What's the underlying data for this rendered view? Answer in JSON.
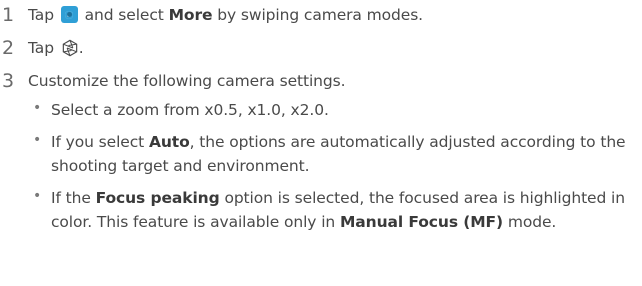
{
  "steps": [
    {
      "number": "1",
      "prefix": "Tap",
      "icon": "camera-app-icon",
      "middle": "and select",
      "bold": "More",
      "suffix": "by swiping camera modes."
    },
    {
      "number": "2",
      "prefix": "Tap",
      "icon": "aperture-settings-icon",
      "suffix": "."
    },
    {
      "number": "3",
      "text": "Customize the following camera settings."
    }
  ],
  "bullets": [
    {
      "marker": "•",
      "text": "Select a zoom from x0.5, x1.0, x2.0."
    },
    {
      "marker": "•",
      "pre": "If you select",
      "bold": "Auto",
      "post": ", the options are automatically adjusted according to the shooting target and environment."
    },
    {
      "marker": "•",
      "pre": "If the",
      "bold": "Focus peaking",
      "mid": "option is selected, the focused area is highlighted in color. This feature is available only in",
      "bold2": "Manual Focus (MF)",
      "post": "mode."
    }
  ],
  "colors": {
    "text": "#4a4a4a",
    "icon_blue": "#2f9fd6"
  }
}
